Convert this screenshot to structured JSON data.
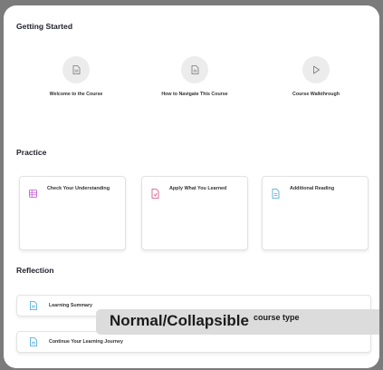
{
  "sections": {
    "getting_started": {
      "title": "Getting Started",
      "items": [
        {
          "label": "Welcome to the Course",
          "icon": "document-icon"
        },
        {
          "label": "How to Navigate This Course",
          "icon": "document-icon"
        },
        {
          "label": "Course Walkthrough",
          "icon": "play-icon"
        }
      ]
    },
    "practice": {
      "title": "Practice",
      "items": [
        {
          "label": "Check Your Understanding",
          "icon": "quiz-icon",
          "color": "#c24bd3"
        },
        {
          "label": "Apply What You Learned",
          "icon": "assignment-icon",
          "color": "#e0457b"
        },
        {
          "label": "Additional Reading",
          "icon": "reading-icon",
          "color": "#3ba6d8"
        }
      ]
    },
    "reflection": {
      "title": "Reflection",
      "items": [
        {
          "label": "Learning Summary",
          "icon": "document-icon",
          "color": "#3ba6d8"
        },
        {
          "label": "Continue Your Learning Journey",
          "icon": "document-icon",
          "color": "#3ba6d8"
        }
      ]
    }
  },
  "overlay": {
    "main": "Normal/Collapsible",
    "sub": "course type"
  }
}
